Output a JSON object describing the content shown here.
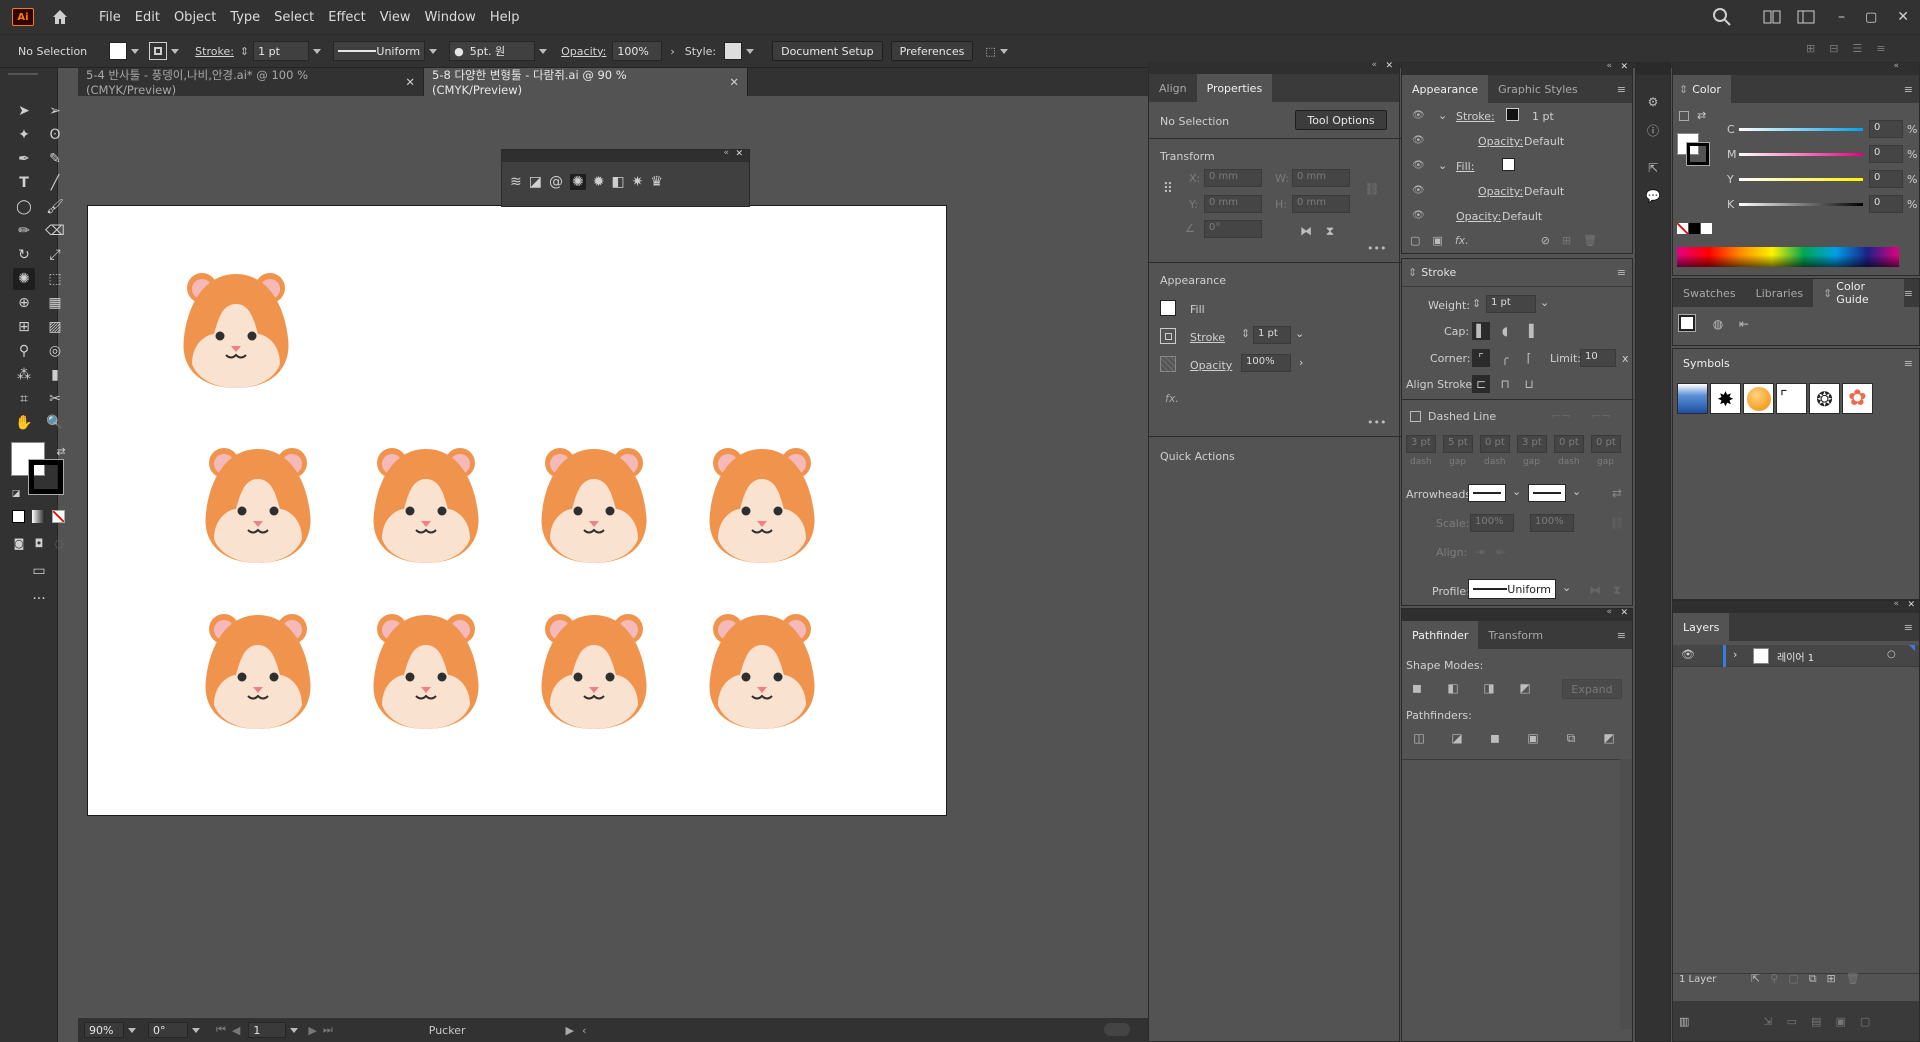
{
  "app": {
    "logo": "Ai"
  },
  "menu": [
    "File",
    "Edit",
    "Object",
    "Type",
    "Select",
    "Effect",
    "View",
    "Window",
    "Help"
  ],
  "control": {
    "selection": "No Selection",
    "stroke_label": "Stroke:",
    "stroke_weight": "1 pt",
    "profile": "Uniform",
    "brush": "5pt. 원",
    "opacity_label": "Opacity:",
    "opacity_value": "100%",
    "style_label": "Style:",
    "document_setup": "Document Setup",
    "preferences": "Preferences"
  },
  "tabs": [
    {
      "label": "5-4 반사툴 - 풍뎅이,나비,안경.ai* @ 100 % (CMYK/Preview)",
      "active": false
    },
    {
      "label": "5-8 다양한 변형툴 - 다람쥐.ai @ 90 % (CMYK/Preview)",
      "active": true
    }
  ],
  "status": {
    "zoom": "90%",
    "rotation": "0°",
    "artboard": "1",
    "tool": "Pucker"
  },
  "properties": {
    "tabs": [
      "Align",
      "Properties"
    ],
    "active_tab": "Properties",
    "no_selection": "No Selection",
    "tool_options": "Tool Options",
    "transform_title": "Transform",
    "x_label": "X:",
    "x_value": "0 mm",
    "y_label": "Y:",
    "y_value": "0 mm",
    "w_label": "W:",
    "w_value": "0 mm",
    "h_label": "H:",
    "h_value": "0 mm",
    "angle_value": "0°",
    "appearance_title": "Appearance",
    "fill_label": "Fill",
    "stroke_label": "Stroke",
    "stroke_value": "1 pt",
    "opacity_label": "Opacity",
    "opacity_value": "100%",
    "fx": "fx.",
    "quick_actions": "Quick Actions"
  },
  "appearance": {
    "tabs": [
      "Appearance",
      "Graphic Styles"
    ],
    "rows": [
      {
        "label": "Stroke:",
        "value": "1 pt"
      },
      {
        "label": "Opacity:",
        "value": "Default"
      },
      {
        "label": "Fill:",
        "value": ""
      },
      {
        "label": "Opacity:",
        "value": "Default"
      },
      {
        "label": "Opacity:",
        "value": "Default"
      }
    ]
  },
  "stroke_panel": {
    "title": "Stroke",
    "weight_label": "Weight:",
    "weight": "1 pt",
    "cap_label": "Cap:",
    "corner_label": "Corner:",
    "limit_label": "Limit:",
    "limit": "10",
    "limit_unit": "x",
    "align_label": "Align Stroke:",
    "dashed": "Dashed Line",
    "dash_values": [
      "3 pt",
      "5 pt",
      "0 pt",
      "3 pt",
      "0 pt",
      "0 pt"
    ],
    "dash_labels": [
      "dash",
      "gap",
      "dash",
      "gap",
      "dash",
      "gap"
    ],
    "arrowheads_label": "Arrowheads:",
    "scale_label": "Scale:",
    "scale1": "100%",
    "scale2": "100%",
    "align2_label": "Align:",
    "profile_label": "Profile:",
    "profile": "Uniform"
  },
  "pathfinder": {
    "tabs": [
      "Pathfinder",
      "Transform"
    ],
    "shape_modes": "Shape Modes:",
    "expand": "Expand",
    "pathfinders": "Pathfinders:"
  },
  "color": {
    "title": "Color",
    "channels": [
      {
        "label": "C",
        "value": "0",
        "unit": "%"
      },
      {
        "label": "M",
        "value": "0",
        "unit": "%"
      },
      {
        "label": "Y",
        "value": "0",
        "unit": "%"
      },
      {
        "label": "K",
        "value": "0",
        "unit": "%"
      }
    ]
  },
  "swatch_tabs": [
    "Swatches",
    "Libraries",
    "Color Guide"
  ],
  "symbols": {
    "title": "Symbols"
  },
  "layers": {
    "title": "Layers",
    "layer_name": "레이어 1",
    "count": "1 Layer"
  },
  "colors": {
    "accent": "#ff7c00",
    "hamster": "#f0944d",
    "face": "#f9e2cf",
    "ear": "#f6b9b9",
    "layer": "#3b7bd9"
  }
}
